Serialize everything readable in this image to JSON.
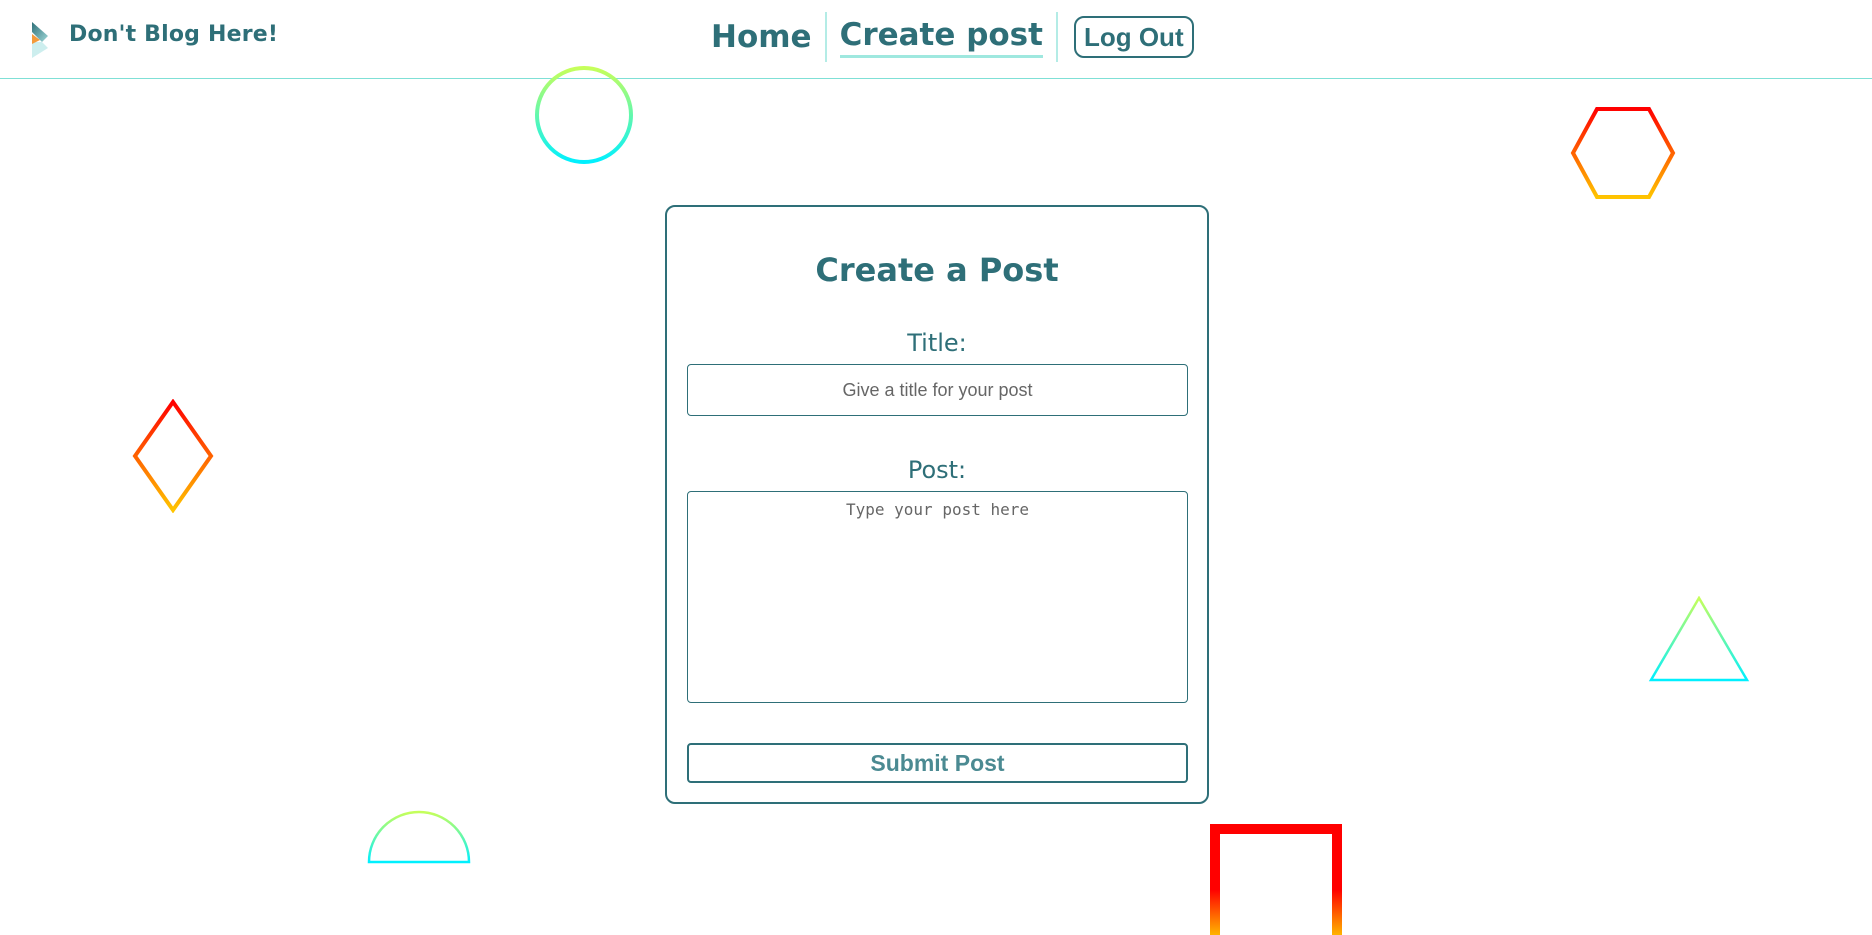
{
  "header": {
    "brand": "Don't Blog Here!",
    "nav": [
      {
        "label": "Home",
        "active": false
      },
      {
        "label": "Create post",
        "active": true
      }
    ],
    "logout_label": "Log Out"
  },
  "form": {
    "heading": "Create a Post",
    "title_label": "Title:",
    "title_placeholder": "Give a title for your post",
    "post_label": "Post:",
    "post_placeholder": "Type your post here",
    "submit_label": "Submit Post"
  },
  "colors": {
    "primary": "#2e6f78",
    "accent": "#7fe0d6",
    "shape_warm_start": "#ff0000",
    "shape_warm_end": "#ffc400",
    "shape_cool_start": "#c6ff5a",
    "shape_cool_end": "#00f0ff"
  },
  "decorations": [
    "circle",
    "hexagon",
    "diamond",
    "triangle",
    "semicircle",
    "square-outline"
  ]
}
